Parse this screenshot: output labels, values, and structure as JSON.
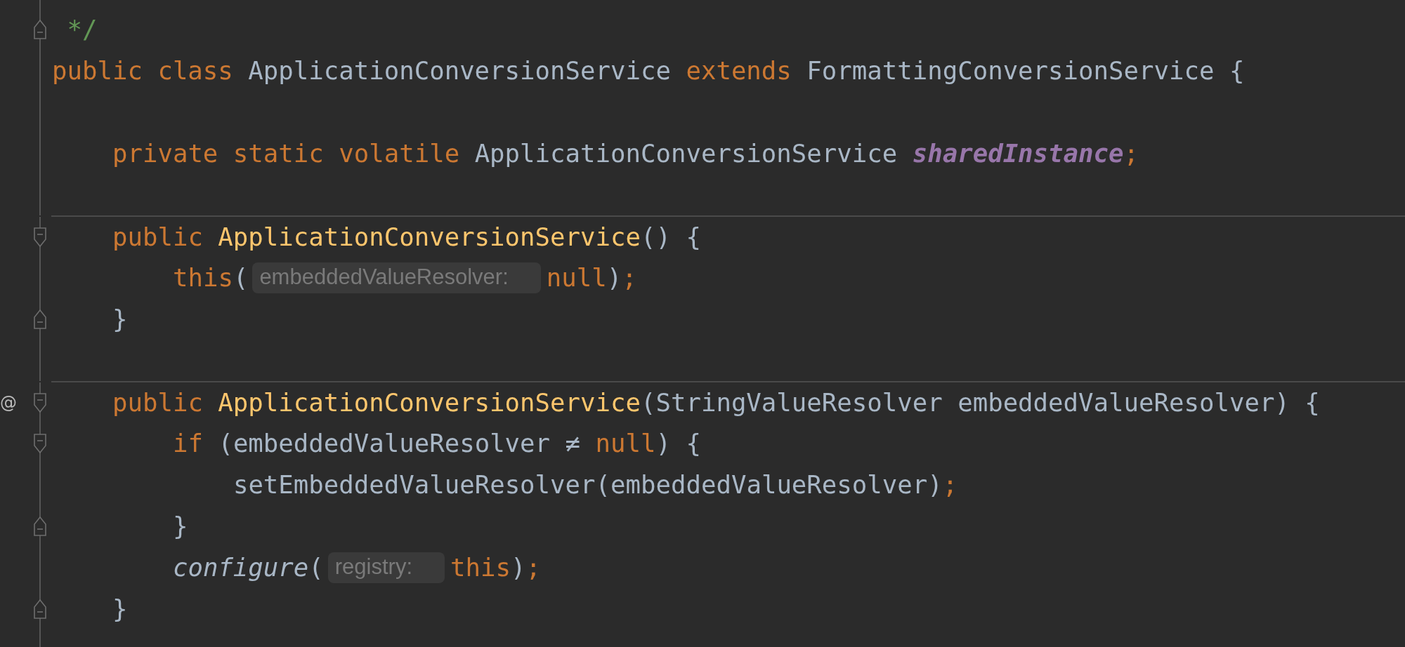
{
  "editor": {
    "lines": [
      {
        "kind": "code",
        "fold_end": true,
        "tokens": [
          {
            "kind": "comment",
            "text": " */"
          }
        ]
      },
      {
        "kind": "code",
        "tokens": [
          {
            "kind": "keyword",
            "text": "public class "
          },
          {
            "kind": "plain",
            "text": "ApplicationConversionService "
          },
          {
            "kind": "keyword",
            "text": "extends "
          },
          {
            "kind": "plain",
            "text": "FormattingConversionService {"
          }
        ],
        "children": [
          {
            "kind": "blank"
          },
          {
            "kind": "code",
            "tokens": [
              {
                "kind": "keyword",
                "text": "private static volatile "
              },
              {
                "kind": "plain",
                "text": "ApplicationConversionService "
              },
              {
                "kind": "field",
                "text": "sharedInstance"
              },
              {
                "kind": "keyword",
                "text": ";"
              }
            ]
          },
          {
            "kind": "blank"
          },
          {
            "kind": "code",
            "separator": true,
            "fold_start": true,
            "tokens": [
              {
                "kind": "keyword",
                "text": "public "
              },
              {
                "kind": "declaration",
                "text": "ApplicationConversionService"
              },
              {
                "kind": "plain",
                "text": "() {"
              }
            ],
            "children": [
              {
                "kind": "code",
                "tokens": [
                  {
                    "kind": "keyword",
                    "text": "this"
                  },
                  {
                    "kind": "plain",
                    "text": "("
                  },
                  {
                    "kind": "hint",
                    "text": "embeddedValueResolver:"
                  },
                  {
                    "kind": "keyword",
                    "text": "null"
                  },
                  {
                    "kind": "plain",
                    "text": ")"
                  },
                  {
                    "kind": "keyword",
                    "text": ";"
                  }
                ]
              }
            ]
          },
          {
            "kind": "code",
            "fold_end": true,
            "tokens": [
              {
                "kind": "plain",
                "text": "}"
              }
            ]
          },
          {
            "kind": "blank"
          },
          {
            "kind": "code",
            "separator": true,
            "fold_start": true,
            "gutter_mark": "@",
            "tokens": [
              {
                "kind": "keyword",
                "text": "public "
              },
              {
                "kind": "declaration",
                "text": "ApplicationConversionService"
              },
              {
                "kind": "plain",
                "text": "(StringValueResolver embeddedValueResolver) {"
              }
            ],
            "children": [
              {
                "kind": "code",
                "fold_start": true,
                "tokens": [
                  {
                    "kind": "keyword",
                    "text": "if "
                  },
                  {
                    "kind": "plain",
                    "text": "(embeddedValueResolver ≠ "
                  },
                  {
                    "kind": "keyword",
                    "text": "null"
                  },
                  {
                    "kind": "plain",
                    "text": ") {"
                  }
                ],
                "children": [
                  {
                    "kind": "code",
                    "tokens": [
                      {
                        "kind": "plain",
                        "text": "setEmbeddedValueResolver(embeddedValueResolver)"
                      },
                      {
                        "kind": "keyword",
                        "text": ";"
                      }
                    ]
                  }
                ]
              },
              {
                "kind": "code",
                "fold_end": true,
                "tokens": [
                  {
                    "kind": "plain",
                    "text": "}"
                  }
                ]
              },
              {
                "kind": "code",
                "tokens": [
                  {
                    "kind": "call",
                    "text": "configure"
                  },
                  {
                    "kind": "plain",
                    "text": "("
                  },
                  {
                    "kind": "hint",
                    "text": "registry:"
                  },
                  {
                    "kind": "keyword",
                    "text": "this"
                  },
                  {
                    "kind": "plain",
                    "text": ")"
                  },
                  {
                    "kind": "keyword",
                    "text": ";"
                  }
                ]
              }
            ]
          },
          {
            "kind": "code",
            "fold_end": true,
            "tokens": [
              {
                "kind": "plain",
                "text": "}"
              }
            ]
          }
        ]
      }
    ]
  }
}
